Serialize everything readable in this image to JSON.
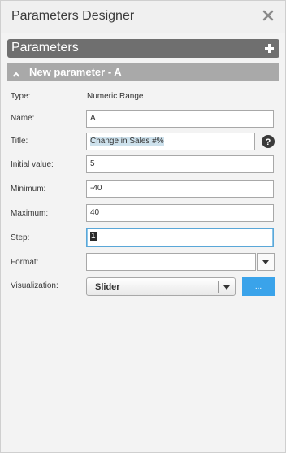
{
  "window": {
    "title": "Parameters Designer"
  },
  "section": {
    "label": "Parameters"
  },
  "parameter": {
    "header": "New parameter - A",
    "type_label": "Type:",
    "type_value": "Numeric Range",
    "name_label": "Name:",
    "name_value": "A",
    "title_label": "Title:",
    "title_value": "Change in Sales #%",
    "initial_label": "Initial value:",
    "initial_value": "5",
    "minimum_label": "Minimum:",
    "minimum_value": "-40",
    "maximum_label": "Maximum:",
    "maximum_value": "40",
    "step_label": "Step:",
    "step_value": "1",
    "format_label": "Format:",
    "format_value": "",
    "visualization_label": "Visualization:",
    "visualization_value": "Slider",
    "more_button_label": "..."
  },
  "icons": {
    "close": "close-icon",
    "add": "plus-icon",
    "collapse": "chevron-up-icon",
    "help": "help-icon",
    "dropdown": "chevron-down-icon"
  },
  "colors": {
    "section_bar": "#6f6f6f",
    "param_bar": "#a9a9a9",
    "accent_button": "#3aa3ea",
    "focus_border": "#5aa7d8"
  }
}
